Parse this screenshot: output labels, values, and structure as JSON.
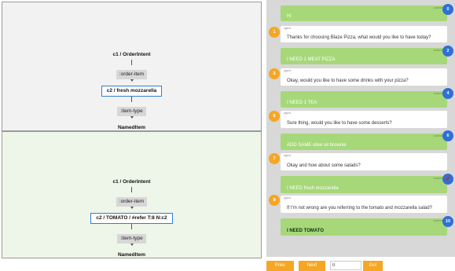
{
  "graph_top": {
    "root": "c1 / OrderIntent",
    "edge1": ":order-item",
    "selected": "c2 / fresh mozzarella",
    "edge2": ":item-type",
    "leaf": "NamedItem"
  },
  "graph_bottom": {
    "root": "c1 / OrderIntent",
    "edge1": ":order-item",
    "selected": "c2 / TOMATO / #refer T:8 N:c2",
    "edge2": ":item-type",
    "leaf": "NamedItem"
  },
  "chat": {
    "customer_tag": "customer",
    "agent_tag": "agent",
    "messages": [
      {
        "role": "customer",
        "text": "Hi",
        "badge": "0"
      },
      {
        "role": "agent",
        "text": "Thanks for choosing Blaze Pizza, what would you like to have today?",
        "badge": "1"
      },
      {
        "role": "customer",
        "text": "I NEED 1 MEAT PIZZA",
        "badge": "2"
      },
      {
        "role": "agent",
        "text": "Okay, would you like to have some drinks with your pizza?",
        "badge": "3"
      },
      {
        "role": "customer",
        "text": "I NEED 1 TEA",
        "badge": "4"
      },
      {
        "role": "agent",
        "text": "Sure thing, would you like to have some desserts?",
        "badge": "5"
      },
      {
        "role": "customer",
        "text": "ADD SAME olive oil brownie",
        "badge": "6"
      },
      {
        "role": "agent",
        "text": "Okay and how about some salads?",
        "badge": "7"
      },
      {
        "role": "customer",
        "text": "I NEED fresh mozzarella",
        "badge": "✔"
      },
      {
        "role": "agent",
        "text": "If I'm not wrong are you referring to the tomato and mozzarella salad?",
        "badge": "9"
      },
      {
        "role": "customer",
        "text": "I NEED TOMATO",
        "badge": "10"
      }
    ]
  },
  "controls": {
    "prev_label": "Prev.",
    "next_label": "Next",
    "input_value": "0",
    "go_label": "Go!"
  }
}
